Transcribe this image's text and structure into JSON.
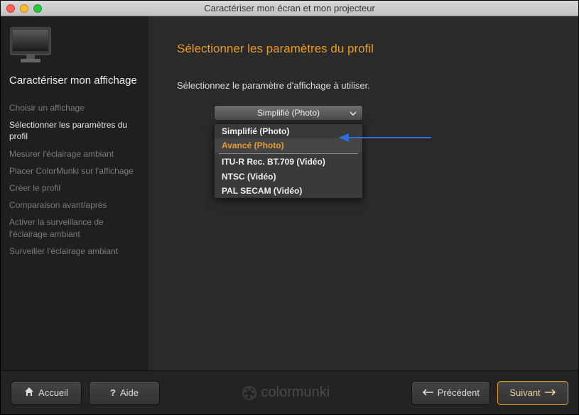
{
  "window": {
    "title": "Caractériser mon écran et mon projecteur"
  },
  "sidebar": {
    "title": "Caractériser mon affichage",
    "steps": [
      {
        "label": "Choisir un affichage",
        "active": false
      },
      {
        "label": "Sélectionner les paramètres du profil",
        "active": true
      },
      {
        "label": "Mesurer l'éclairage ambiant",
        "active": false
      },
      {
        "label": "Placer ColorMunki sur l'affichage",
        "active": false
      },
      {
        "label": "Créer le profil",
        "active": false
      },
      {
        "label": "Comparaison avant/après",
        "active": false
      },
      {
        "label": "Activer la surveillance de l'éclairage ambiant",
        "active": false
      },
      {
        "label": "Surveiller l'éclairage ambiant",
        "active": false
      }
    ]
  },
  "main": {
    "heading": "Sélectionner les paramètres du profil",
    "instruction": "Sélectionnez le paramètre d'affichage à utiliser.",
    "dropdown": {
      "selected": "Simplifié (Photo)",
      "options_group1": [
        "Simplifié (Photo)",
        "Avancé (Photo)"
      ],
      "options_group2": [
        "ITU-R Rec. BT.709 (Vidéo)",
        "NTSC (Vidéo)",
        "PAL SECAM (Vidéo)"
      ],
      "highlighted": "Avancé (Photo)"
    }
  },
  "footer": {
    "home": "Accueil",
    "help": "Aide",
    "brand": "colormunki",
    "prev": "Précédent",
    "next": "Suivant"
  }
}
